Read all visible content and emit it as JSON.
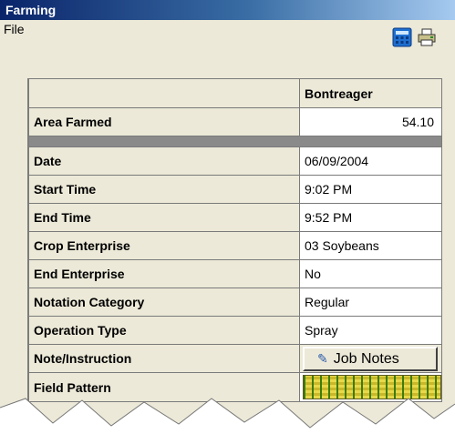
{
  "window": {
    "title": "Farming"
  },
  "menu": {
    "file_label": "File"
  },
  "toolbar": {
    "icons": [
      "calculator-icon",
      "printer-icon"
    ]
  },
  "grid": {
    "column_header": "Bontreager",
    "area_farmed": {
      "label": "Area Farmed",
      "value": "54.10"
    },
    "rows": [
      {
        "label": "Date",
        "value": "06/09/2004"
      },
      {
        "label": "Start Time",
        "value": "9:02 PM"
      },
      {
        "label": "End Time",
        "value": "9:52 PM"
      },
      {
        "label": "Crop Enterprise",
        "value": "03 Soybeans"
      },
      {
        "label": "End Enterprise",
        "value": "No"
      },
      {
        "label": "Notation Category",
        "value": "Regular"
      },
      {
        "label": "Operation Type",
        "value": "Spray"
      }
    ],
    "note_instruction": {
      "label": "Note/Instruction",
      "button_label": "Job Notes"
    },
    "field_pattern": {
      "label": "Field Pattern",
      "pattern": "soybean-rows"
    }
  },
  "colors": {
    "titlebar_start": "#0a246a",
    "titlebar_end": "#a6caf0",
    "panel": "#ece9d8",
    "separator": "#8a8a8a"
  }
}
